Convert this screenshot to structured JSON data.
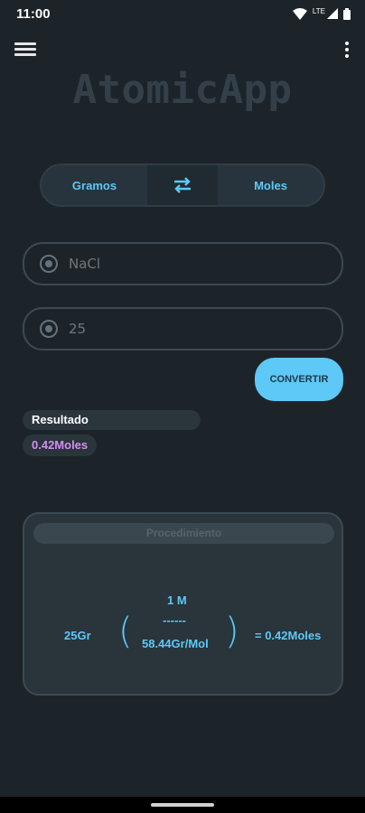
{
  "status_bar": {
    "time": "11:00",
    "network": "LTE"
  },
  "app": {
    "title": "AtomicApp"
  },
  "switcher": {
    "left_label": "Gramos",
    "right_label": "Moles",
    "swap_icon": "swap-arrows-icon"
  },
  "inputs": {
    "compound": {
      "placeholder": "NaCl",
      "value": ""
    },
    "amount": {
      "placeholder": "25",
      "value": ""
    }
  },
  "actions": {
    "convert_label": "CONVERTIR"
  },
  "result": {
    "label": "Resultado",
    "value": "0.42Moles"
  },
  "procedure": {
    "title": "Procedimiento",
    "grams": "25Gr",
    "numerator": "1 M",
    "divider": "------",
    "denominator": "58.44Gr/Mol",
    "result": "= 0.42Moles"
  },
  "colors": {
    "accent": "#5ec8f6",
    "result": "#d48ef0",
    "background": "#1d2429"
  }
}
